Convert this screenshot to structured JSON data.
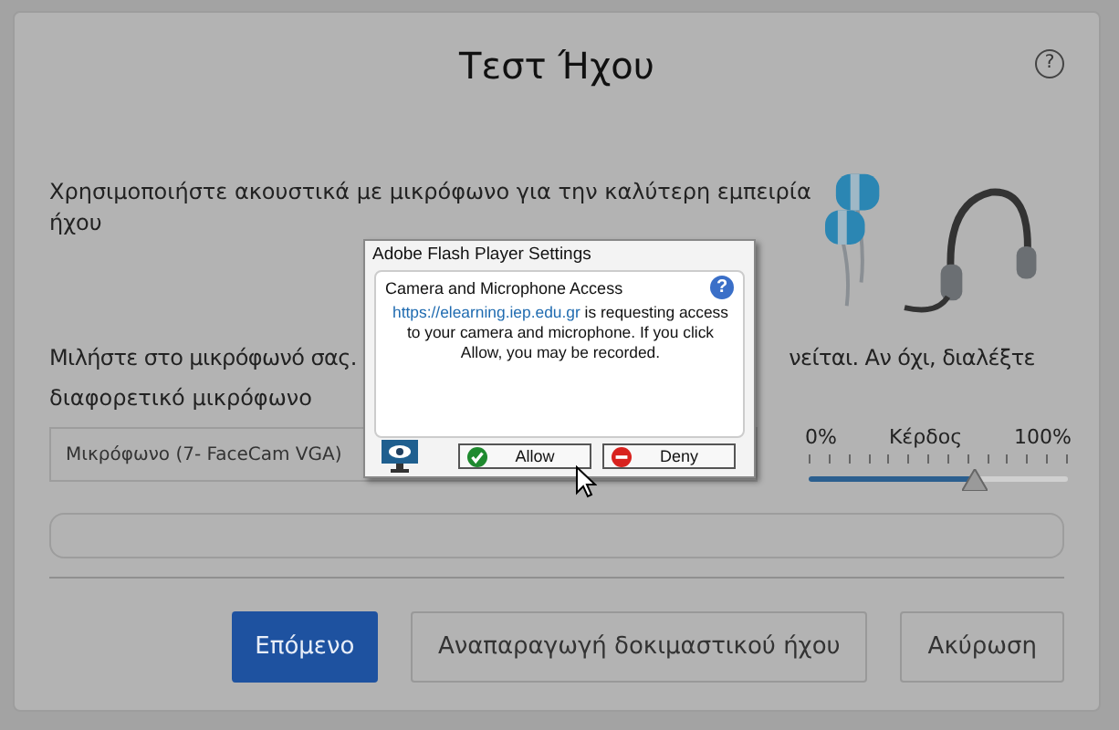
{
  "dialog": {
    "title": "Τεστ Ήχου",
    "help": "?"
  },
  "instruction": "Χρησιμοποιήστε ακουστικά με μικρόφωνο για την καλύτερη εμπειρία ήχου",
  "speak_hint": {
    "line_start": "Μιλήστε στο μικρόφωνό σας.",
    "line_end": "νείται. Αν όχι, διαλέξτε",
    "line_2": "διαφορετικό μικρόφωνο"
  },
  "microphone_select": {
    "value": "Μικρόφωνο (7- FaceCam VGA)"
  },
  "gain": {
    "min_label": "0%",
    "label": "Κέρδος",
    "max_label": "100%",
    "level": 0.64
  },
  "buttons": [
    {
      "label": "Επόμενο",
      "kind": "primary"
    },
    {
      "label": "Αναπαραγωγή δοκιμαστικού ήχου",
      "kind": "secondary"
    },
    {
      "label": "Ακύρωση",
      "kind": "secondary"
    }
  ],
  "flash_popup": {
    "title": "Adobe Flash Player Settings",
    "heading": "Camera and Microphone Access",
    "help": "?",
    "link": "https://elearning.iep.edu.gr",
    "message": "is requesting access to your camera and microphone. If you click Allow, you may be recorded.",
    "buttons": [
      {
        "label": "Allow",
        "kind": "allow"
      },
      {
        "label": "Deny",
        "kind": "deny"
      }
    ]
  }
}
